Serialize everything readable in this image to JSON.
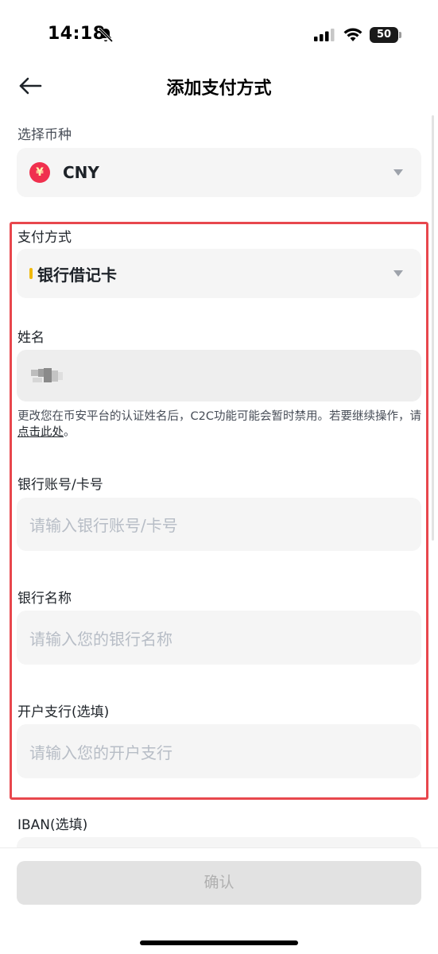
{
  "status_bar": {
    "time": "14:18",
    "battery": "50"
  },
  "header": {
    "title": "添加支付方式"
  },
  "currency": {
    "label": "选择币种",
    "symbol": "¥",
    "value": "CNY"
  },
  "payment_method": {
    "label": "支付方式",
    "value": "银行借记卡"
  },
  "name": {
    "label": "姓名"
  },
  "notice": {
    "text": "更改您在币安平台的认证姓名后，C2C功能可能会暂时禁用。若要继续操作，请",
    "link": "点击此处",
    "suffix": "。"
  },
  "bank_account": {
    "label": "银行账号/卡号",
    "placeholder": "请输入银行账号/卡号"
  },
  "bank_name": {
    "label": "银行名称",
    "placeholder": "请输入您的银行名称"
  },
  "branch": {
    "label": "开户支行(选填)",
    "placeholder": "请输入您的开户支行"
  },
  "iban": {
    "label": "IBAN(选填)"
  },
  "confirm": {
    "label": "确认"
  },
  "colors": {
    "highlight": "#e8474d",
    "accent": "#f0b90b",
    "cny_badge": "#f0304e"
  }
}
